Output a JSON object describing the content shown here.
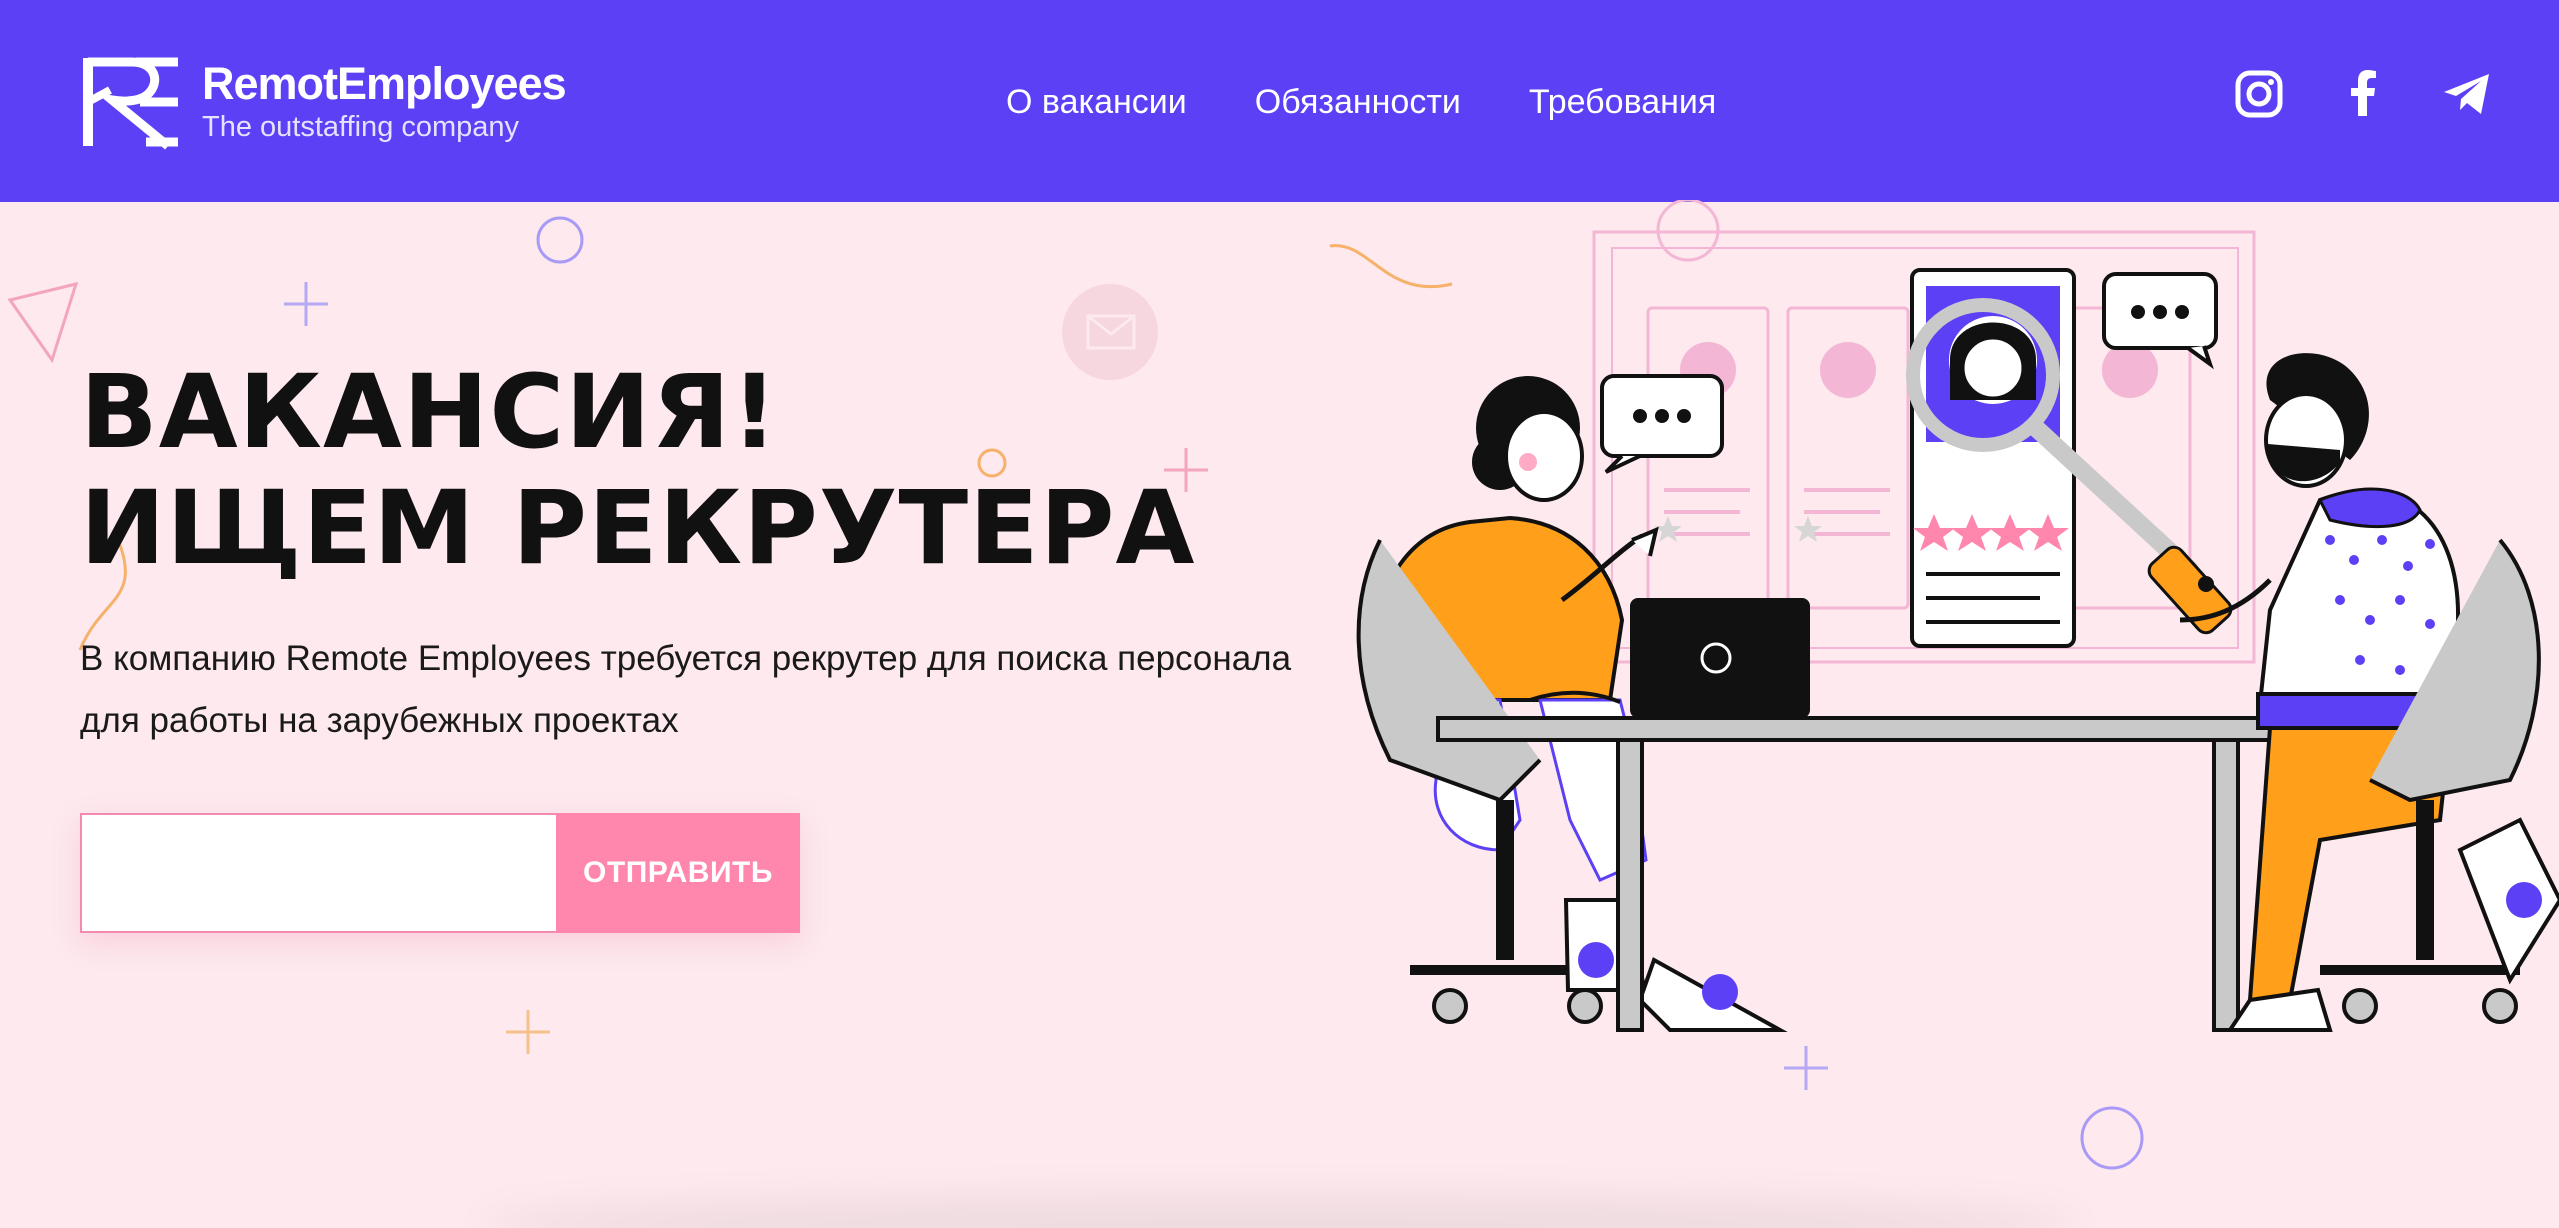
{
  "brand": {
    "name": "RemotEmployees",
    "tagline": "The outstaffing company"
  },
  "nav": {
    "items": [
      "О вакансии",
      "Обязанности",
      "Требования"
    ]
  },
  "social": [
    "instagram-icon",
    "facebook-icon",
    "telegram-icon"
  ],
  "hero": {
    "title_line1": "ВАКАНСИЯ!",
    "title_line2": "ИЩЕМ РЕКРУТЕРА",
    "description": "В компанию Remote Employees требуется рекрутер для поиска персонала для работы на зарубежных проектах"
  },
  "form": {
    "input_value": "",
    "submit_label": "ОТПРАВИТЬ"
  },
  "colors": {
    "header": "#5b40f5",
    "background": "#fde9ee",
    "accent_pink": "#ff87ad",
    "orange": "#ff9f1a",
    "purple": "#5b40f5"
  }
}
